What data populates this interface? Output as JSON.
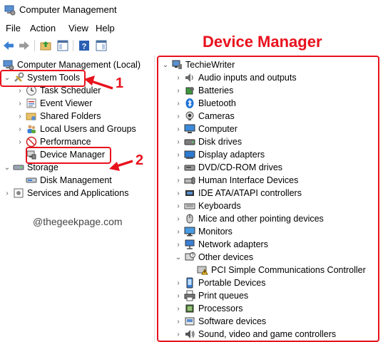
{
  "window": {
    "title": "Computer Management"
  },
  "menu": [
    "File",
    "Action",
    "View",
    "Help"
  ],
  "left_tree": {
    "root": "Computer Management (Local)",
    "system_tools": "System Tools",
    "task_scheduler": "Task Scheduler",
    "event_viewer": "Event Viewer",
    "shared_folders": "Shared Folders",
    "local_users": "Local Users and Groups",
    "performance": "Performance",
    "device_manager": "Device Manager",
    "storage": "Storage",
    "disk_management": "Disk Management",
    "services": "Services and Applications"
  },
  "right_tree": {
    "root": "TechieWriter",
    "items": [
      "Audio inputs and outputs",
      "Batteries",
      "Bluetooth",
      "Cameras",
      "Computer",
      "Disk drives",
      "Display adapters",
      "DVD/CD-ROM drives",
      "Human Interface Devices",
      "IDE ATA/ATAPI controllers",
      "Keyboards",
      "Mice and other pointing devices",
      "Monitors",
      "Network adapters",
      "Other devices",
      "PCI Simple Communications Controller",
      "Portable Devices",
      "Print queues",
      "Processors",
      "Software devices",
      "Sound, video and game controllers"
    ]
  },
  "annotations": {
    "heading": "Device Manager",
    "step1": "1",
    "step2": "2",
    "accent_color": "#e8121d"
  },
  "watermark": "@thegeekpage.com"
}
